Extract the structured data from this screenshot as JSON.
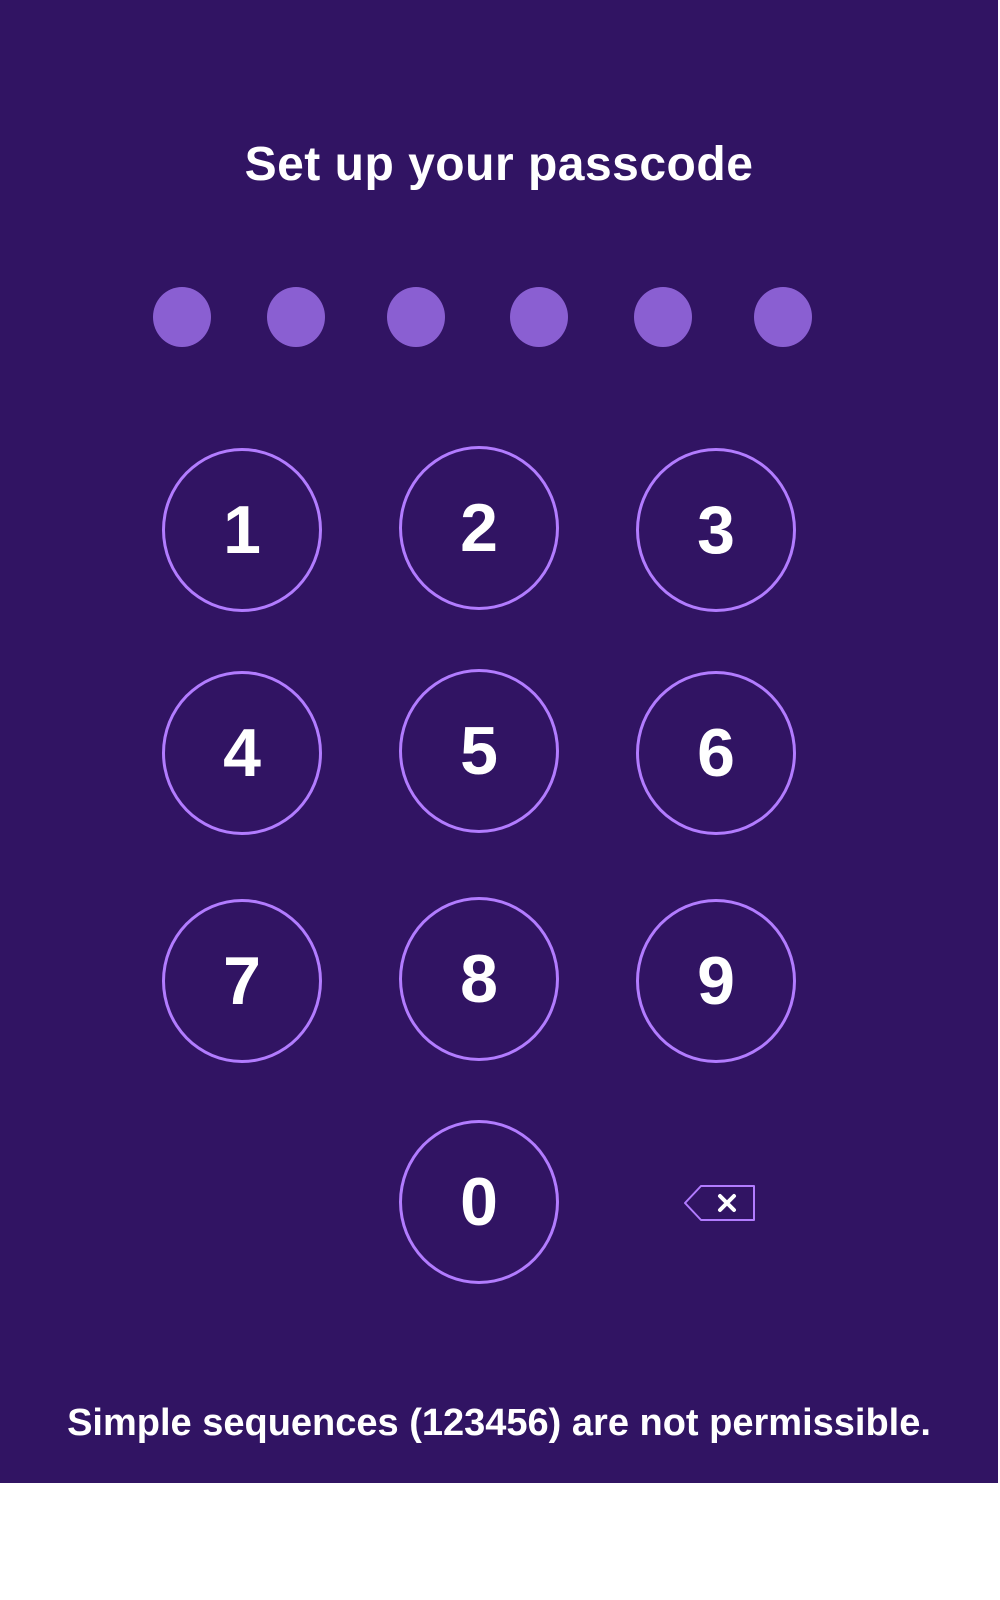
{
  "screen": {
    "title": "Set up your passcode",
    "hint": "Simple sequences (123456) are not permissible."
  },
  "passcode": {
    "length": 6,
    "entered": 0,
    "dot_color": "#8a5fd2"
  },
  "keypad": {
    "keys": [
      "1",
      "2",
      "3",
      "4",
      "5",
      "6",
      "7",
      "8",
      "9",
      "0"
    ],
    "backspace_icon": "backspace-icon",
    "ring_color": "#b27cff"
  },
  "colors": {
    "background": "#311463",
    "text": "#ffffff"
  }
}
